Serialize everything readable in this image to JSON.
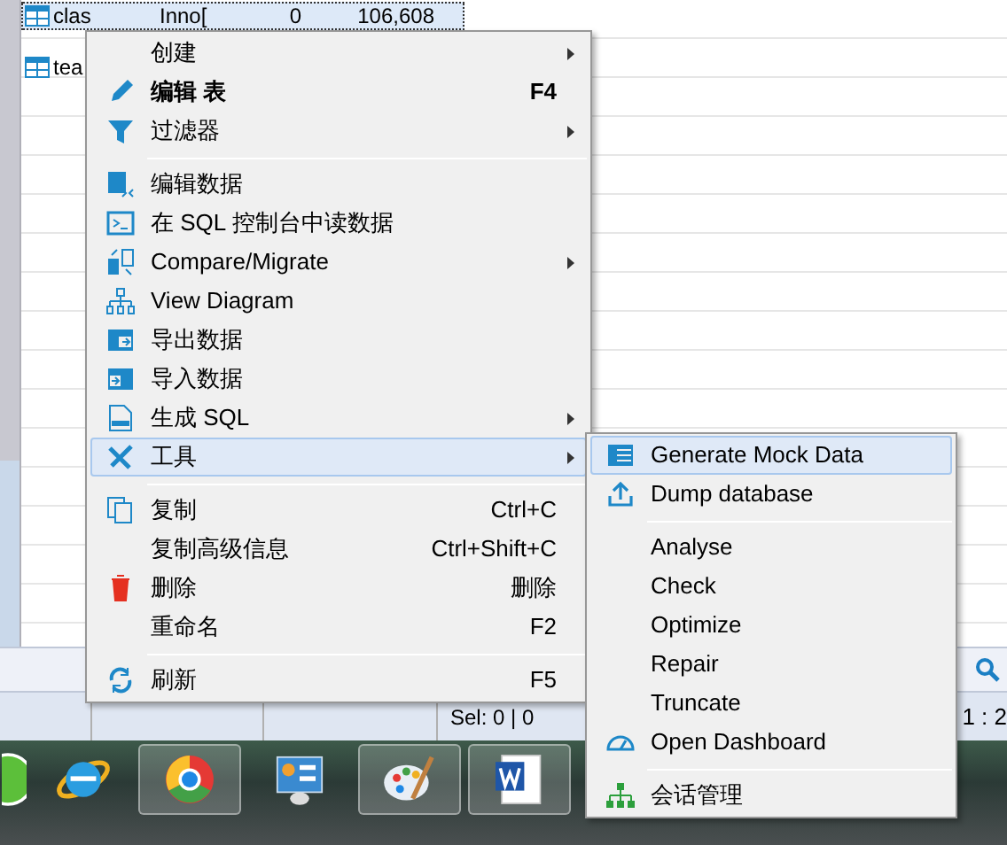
{
  "table": {
    "rows": [
      {
        "selected": true,
        "cells": [
          "clas",
          "Inno[",
          "0",
          "106,608"
        ]
      },
      {
        "selected": false,
        "cells": [
          "tea"
        ]
      }
    ]
  },
  "context_menu": {
    "items": [
      {
        "kind": "item",
        "label": "创建",
        "submenu": true,
        "selected": false
      },
      {
        "kind": "item",
        "label": "编辑 表",
        "shortcut": "F4",
        "default": true,
        "selected": false
      },
      {
        "kind": "item",
        "label": "过滤器",
        "submenu": true,
        "selected": false
      },
      {
        "kind": "separator"
      },
      {
        "kind": "item",
        "label": "编辑数据",
        "selected": false
      },
      {
        "kind": "item",
        "label": "在 SQL 控制台中读数据",
        "selected": false
      },
      {
        "kind": "item",
        "label": "Compare/Migrate",
        "submenu": true,
        "selected": false
      },
      {
        "kind": "item",
        "label": "View Diagram",
        "selected": false
      },
      {
        "kind": "item",
        "label": "导出数据",
        "selected": false
      },
      {
        "kind": "item",
        "label": "导入数据",
        "selected": false
      },
      {
        "kind": "item",
        "label": "生成 SQL",
        "submenu": true,
        "selected": false
      },
      {
        "kind": "item",
        "label": "工具",
        "submenu": true,
        "selected": true
      },
      {
        "kind": "separator"
      },
      {
        "kind": "item",
        "label": "复制",
        "shortcut": "Ctrl+C",
        "selected": false
      },
      {
        "kind": "item",
        "label": "复制高级信息",
        "shortcut": "Ctrl+Shift+C",
        "selected": false
      },
      {
        "kind": "item",
        "label": "删除",
        "shortcut": "删除",
        "selected": false
      },
      {
        "kind": "item",
        "label": "重命名",
        "shortcut": "F2",
        "selected": false
      },
      {
        "kind": "separator"
      },
      {
        "kind": "item",
        "label": "刷新",
        "shortcut": "F5",
        "selected": false
      }
    ]
  },
  "tools_submenu": {
    "items": [
      {
        "kind": "item",
        "label": "Generate Mock Data",
        "selected": true
      },
      {
        "kind": "item",
        "label": "Dump database",
        "selected": false
      },
      {
        "kind": "separator"
      },
      {
        "kind": "item",
        "label": "Analyse",
        "selected": false
      },
      {
        "kind": "item",
        "label": "Check",
        "selected": false
      },
      {
        "kind": "item",
        "label": "Optimize",
        "selected": false
      },
      {
        "kind": "item",
        "label": "Repair",
        "selected": false
      },
      {
        "kind": "item",
        "label": "Truncate",
        "selected": false
      },
      {
        "kind": "item",
        "label": "Open Dashboard",
        "selected": false
      },
      {
        "kind": "separator"
      },
      {
        "kind": "item",
        "label": "会话管理",
        "selected": false
      }
    ]
  },
  "status_bar": {
    "selection": "Sel: 0 | 0",
    "position": "1 : 2"
  },
  "taskbar": {
    "apps": [
      {
        "highlighted": false
      },
      {
        "highlighted": false
      },
      {
        "highlighted": true
      },
      {
        "highlighted": false
      },
      {
        "highlighted": true
      },
      {
        "highlighted": true
      }
    ]
  }
}
